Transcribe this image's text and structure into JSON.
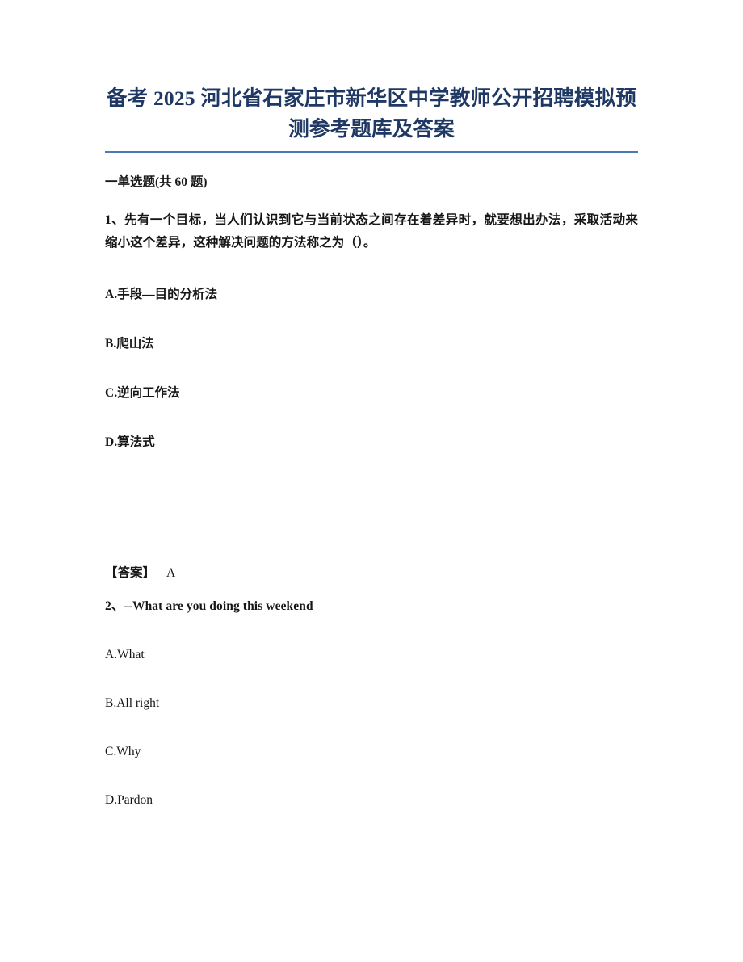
{
  "document": {
    "title": "备考 2025 河北省石家庄市新华区中学教师公开招聘模拟预测参考题库及答案",
    "rule_color": "#4a79b8",
    "title_color": "#1f3864"
  },
  "section": {
    "header": "一单选题(共 60 题)"
  },
  "questions": [
    {
      "number": "1、",
      "stem": "1、先有一个目标，当人们认识到它与当前状态之间存在着差异时，就要想出办法，采取活动来缩小这个差异，这种解决问题的方法称之为（）。",
      "options": [
        "A.手段—目的分析法",
        "B.爬山法",
        "C.逆向工作法",
        "D.算法式"
      ],
      "answer_label": "【答案】",
      "answer_value": "A"
    },
    {
      "number": "2、",
      "stem": "2、--What are you doing this weekend",
      "options": [
        "A.What",
        "B.All right",
        "C.Why",
        "D.Pardon"
      ]
    }
  ]
}
